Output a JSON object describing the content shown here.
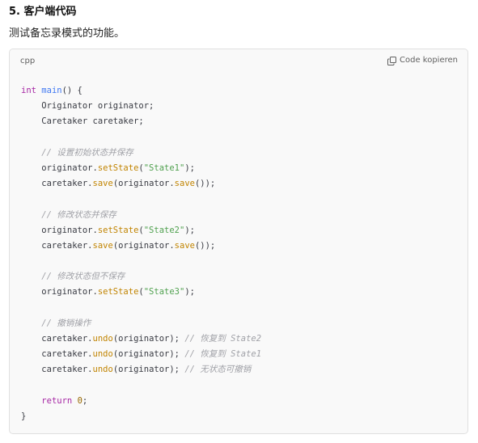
{
  "section": {
    "heading": "5. 客户端代码",
    "description": "测试备忘录模式的功能。"
  },
  "code_block": {
    "language": "cpp",
    "copy_label": "Code kopieren",
    "copy_icon": "copy-icon",
    "lines": [
      [
        {
          "t": "int",
          "k": "kw"
        },
        {
          "t": " ",
          "k": "plain"
        },
        {
          "t": "main",
          "k": "fn"
        },
        {
          "t": "() {",
          "k": "plain"
        }
      ],
      [
        {
          "t": "    Originator originator;",
          "k": "plain"
        }
      ],
      [
        {
          "t": "    Caretaker caretaker;",
          "k": "plain"
        }
      ],
      [],
      [
        {
          "t": "    ",
          "k": "plain"
        },
        {
          "t": "// 设置初始状态并保存",
          "k": "cmt"
        }
      ],
      [
        {
          "t": "    originator.",
          "k": "plain"
        },
        {
          "t": "setState",
          "k": "method"
        },
        {
          "t": "(",
          "k": "plain"
        },
        {
          "t": "\"State1\"",
          "k": "str"
        },
        {
          "t": ");",
          "k": "plain"
        }
      ],
      [
        {
          "t": "    caretaker.",
          "k": "plain"
        },
        {
          "t": "save",
          "k": "method"
        },
        {
          "t": "(originator.",
          "k": "plain"
        },
        {
          "t": "save",
          "k": "method"
        },
        {
          "t": "());",
          "k": "plain"
        }
      ],
      [],
      [
        {
          "t": "    ",
          "k": "plain"
        },
        {
          "t": "// 修改状态并保存",
          "k": "cmt"
        }
      ],
      [
        {
          "t": "    originator.",
          "k": "plain"
        },
        {
          "t": "setState",
          "k": "method"
        },
        {
          "t": "(",
          "k": "plain"
        },
        {
          "t": "\"State2\"",
          "k": "str"
        },
        {
          "t": ");",
          "k": "plain"
        }
      ],
      [
        {
          "t": "    caretaker.",
          "k": "plain"
        },
        {
          "t": "save",
          "k": "method"
        },
        {
          "t": "(originator.",
          "k": "plain"
        },
        {
          "t": "save",
          "k": "method"
        },
        {
          "t": "());",
          "k": "plain"
        }
      ],
      [],
      [
        {
          "t": "    ",
          "k": "plain"
        },
        {
          "t": "// 修改状态但不保存",
          "k": "cmt"
        }
      ],
      [
        {
          "t": "    originator.",
          "k": "plain"
        },
        {
          "t": "setState",
          "k": "method"
        },
        {
          "t": "(",
          "k": "plain"
        },
        {
          "t": "\"State3\"",
          "k": "str"
        },
        {
          "t": ");",
          "k": "plain"
        }
      ],
      [],
      [
        {
          "t": "    ",
          "k": "plain"
        },
        {
          "t": "// 撤销操作",
          "k": "cmt"
        }
      ],
      [
        {
          "t": "    caretaker.",
          "k": "plain"
        },
        {
          "t": "undo",
          "k": "method"
        },
        {
          "t": "(originator); ",
          "k": "plain"
        },
        {
          "t": "// 恢复到 State2",
          "k": "cmt"
        }
      ],
      [
        {
          "t": "    caretaker.",
          "k": "plain"
        },
        {
          "t": "undo",
          "k": "method"
        },
        {
          "t": "(originator); ",
          "k": "plain"
        },
        {
          "t": "// 恢复到 State1",
          "k": "cmt"
        }
      ],
      [
        {
          "t": "    caretaker.",
          "k": "plain"
        },
        {
          "t": "undo",
          "k": "method"
        },
        {
          "t": "(originator); ",
          "k": "plain"
        },
        {
          "t": "// 无状态可撤销",
          "k": "cmt"
        }
      ],
      [],
      [
        {
          "t": "    ",
          "k": "plain"
        },
        {
          "t": "return",
          "k": "kw"
        },
        {
          "t": " ",
          "k": "plain"
        },
        {
          "t": "0",
          "k": "num"
        },
        {
          "t": ";",
          "k": "plain"
        }
      ],
      [
        {
          "t": "}",
          "k": "plain"
        }
      ]
    ]
  },
  "colors": {
    "keyword": "#a626a4",
    "function": "#4078f2",
    "method": "#c18401",
    "string": "#50a14f",
    "number": "#986801",
    "comment": "#a0a1a7",
    "code_background": "#f9f9f9"
  }
}
